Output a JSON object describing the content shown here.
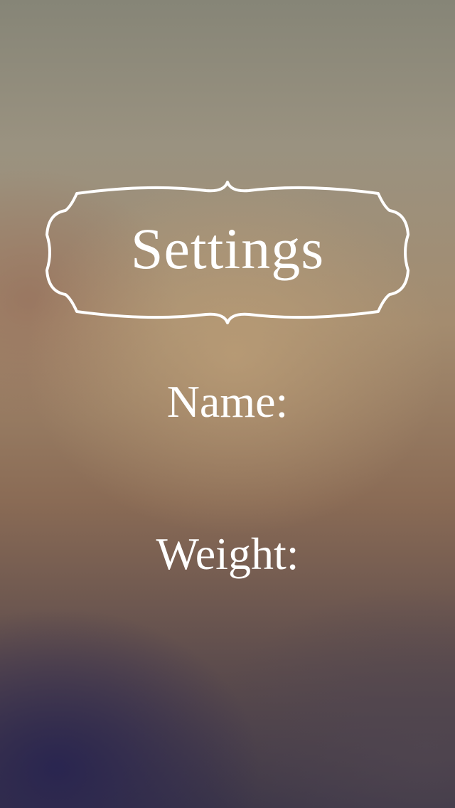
{
  "header": {
    "title": "Settings",
    "frame_icon": "ornate-label-frame"
  },
  "fields": {
    "name_label": "Name:",
    "weight_label": "Weight:"
  },
  "colors": {
    "text": "#ffffff",
    "frame_stroke": "#ffffff"
  }
}
